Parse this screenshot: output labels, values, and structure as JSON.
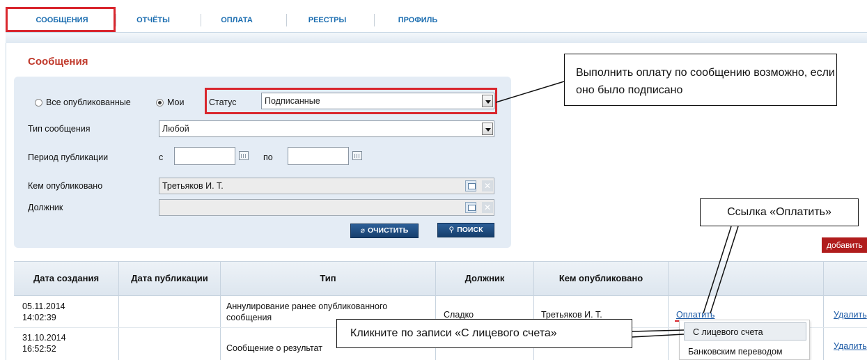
{
  "nav": {
    "items": [
      "СООБЩЕНИЯ",
      "ОТЧЁТЫ",
      "ОПЛАТА",
      "РЕЕСТРЫ",
      "ПРОФИЛЬ"
    ]
  },
  "page": {
    "title": "Сообщения"
  },
  "filters": {
    "radio_all": "Все опубликованные",
    "radio_mine": "Мои",
    "status_label": "Статус",
    "status_value": "Подписанные",
    "type_label": "Тип сообщения",
    "type_value": "Любой",
    "period_label": "Период публикации",
    "period_from": "с",
    "period_to": "по",
    "published_by_label": "Кем опубликовано",
    "published_by_value": "Третьяков И. Т.",
    "debtor_label": "Должник",
    "debtor_value": "",
    "clear_button": "ОЧИСТИТЬ",
    "search_button": "ПОИСК"
  },
  "actions": {
    "add_button": "добавить"
  },
  "table": {
    "headers": [
      "Дата создания",
      "Дата публикации",
      "Тип",
      "Должник",
      "Кем опубликовано"
    ],
    "rows": [
      {
        "created": "05.11.2014 14:02:39",
        "published": "",
        "type": "Аннулирование ранее опубликованного сообщения",
        "debtor": "Сладко",
        "published_by": "Третьяков И. Т.",
        "pay": "Оплатить",
        "delete": "Удалить"
      },
      {
        "created": "31.10.2014 16:52:52",
        "published": "",
        "type": "Сообщение о результат",
        "debtor": "",
        "published_by": "",
        "pay": "",
        "delete": "Удалить"
      }
    ]
  },
  "pay_menu": {
    "items": [
      "С лицевого счета",
      "Банковским переводом"
    ]
  },
  "callouts": {
    "status_note": "Выполнить оплату по сообщению возможно, если оно было подписано",
    "pay_link_note": "Ссылка «Оплатить»",
    "menu_note": "Кликните по записи «С лицевого счета»"
  },
  "colors": {
    "accent": "#1b6db0",
    "title": "#c0392b",
    "highlight": "#d9272e",
    "add_button": "#b01c1c",
    "link": "#1c5aa6"
  }
}
